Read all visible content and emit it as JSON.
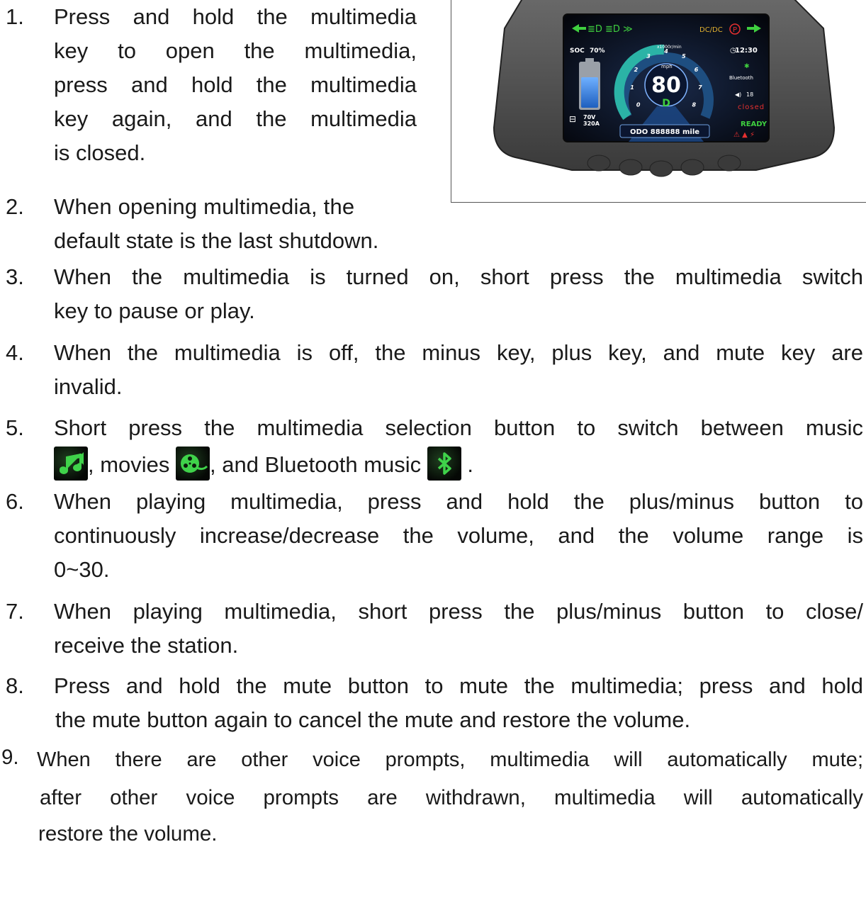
{
  "dashboard": {
    "speed": "80",
    "speed_unit": "mph",
    "rpm_unit": "x1000r/min",
    "rpm_ticks": [
      "0",
      "1",
      "2",
      "3",
      "4",
      "5",
      "6",
      "7",
      "8"
    ],
    "soc_label": "SOC",
    "soc_value": "70%",
    "clock": "12:30",
    "bluetooth_label": "Bluetooth",
    "volume": "18",
    "media_status": "closed",
    "gear": "D",
    "battery_voltage": "70V",
    "battery_current": "320A",
    "odometer": "ODO 888888 mile",
    "ready": "READY",
    "top_indicators": "DC/DC",
    "parking": "P",
    "battery_level": 0.7
  },
  "items": [
    {
      "num": "1.",
      "lines": [
        "Press and hold the multimedia",
        "key to open the multimedia,",
        "press and hold the multimedia",
        "key again, and the multimedia",
        "is closed."
      ]
    },
    {
      "num": "2.",
      "lines": [
        "When opening multimedia, the",
        "default state is the last shutdown."
      ]
    },
    {
      "num": "3.",
      "lines": [
        "When the multimedia is turned on, short press the  multimedia switch",
        "key to pause or play."
      ]
    },
    {
      "num": "4.",
      "lines": [
        "When the multimedia is off, the minus key, plus key, and mute key are",
        "invalid."
      ]
    },
    {
      "num": "5.",
      "line1": "Short press the multimedia selection button to switch between music",
      "seg_a": ", movies",
      "seg_b": ", and Bluetooth music",
      "seg_c": "."
    },
    {
      "num": "6.",
      "lines": [
        "When playing multimedia, press and hold the plus/minus button to",
        "continuously increase/decrease the volume, and the volume range is",
        "0~30."
      ]
    },
    {
      "num": "7.",
      "lines": [
        "When playing multimedia, short press the plus/minus button to close/",
        "receive the station."
      ]
    },
    {
      "num": "8.",
      "lines": [
        "Press and hold the mute button to mute the multimedia; press and hold",
        "the mute button again to cancel the mute and restore the volume."
      ]
    },
    {
      "num": "9.",
      "lines": [
        "When there are other voice prompts, multimedia will automatically mute;",
        "after other voice prompts are withdrawn, multimedia will automatically",
        "restore the volume."
      ]
    }
  ],
  "icons": {
    "music": "music-note-icon",
    "movies": "film-reel-icon",
    "bluetooth": "bluetooth-icon"
  }
}
